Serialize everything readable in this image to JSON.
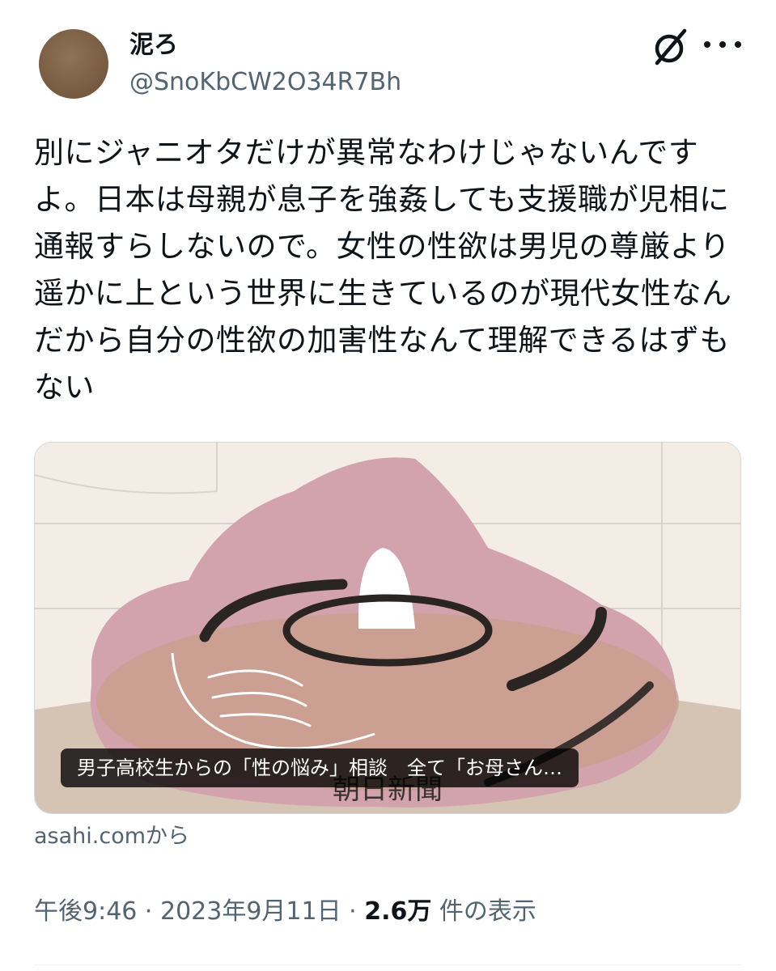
{
  "author": {
    "display_name": "泥ろ",
    "handle": "@SnoKbCW2O34R7Bh"
  },
  "icons": {
    "grok": "grok-icon",
    "more": "more-icon"
  },
  "tweet": {
    "text": "別にジャニオタだけが異常なわけじゃないんですよ。日本は母親が息子を強姦しても支援職が児相に通報すらしないので。女性の性欲は男児の尊厳より遥かに上という世界に生きているのが現代女性なんだから自分の性欲の加害性なんて理解できるはずもない"
  },
  "card": {
    "caption": "男子高校生からの「性の悩み」相談　全て「お母さん…",
    "logo_text": "朝日新聞",
    "source": "asahi.comから"
  },
  "meta": {
    "time": "午後9:46",
    "sep1": " · ",
    "date": "2023年9月11日",
    "sep2": " · ",
    "views": "2.6万",
    "views_suffix": " 件の表示"
  }
}
